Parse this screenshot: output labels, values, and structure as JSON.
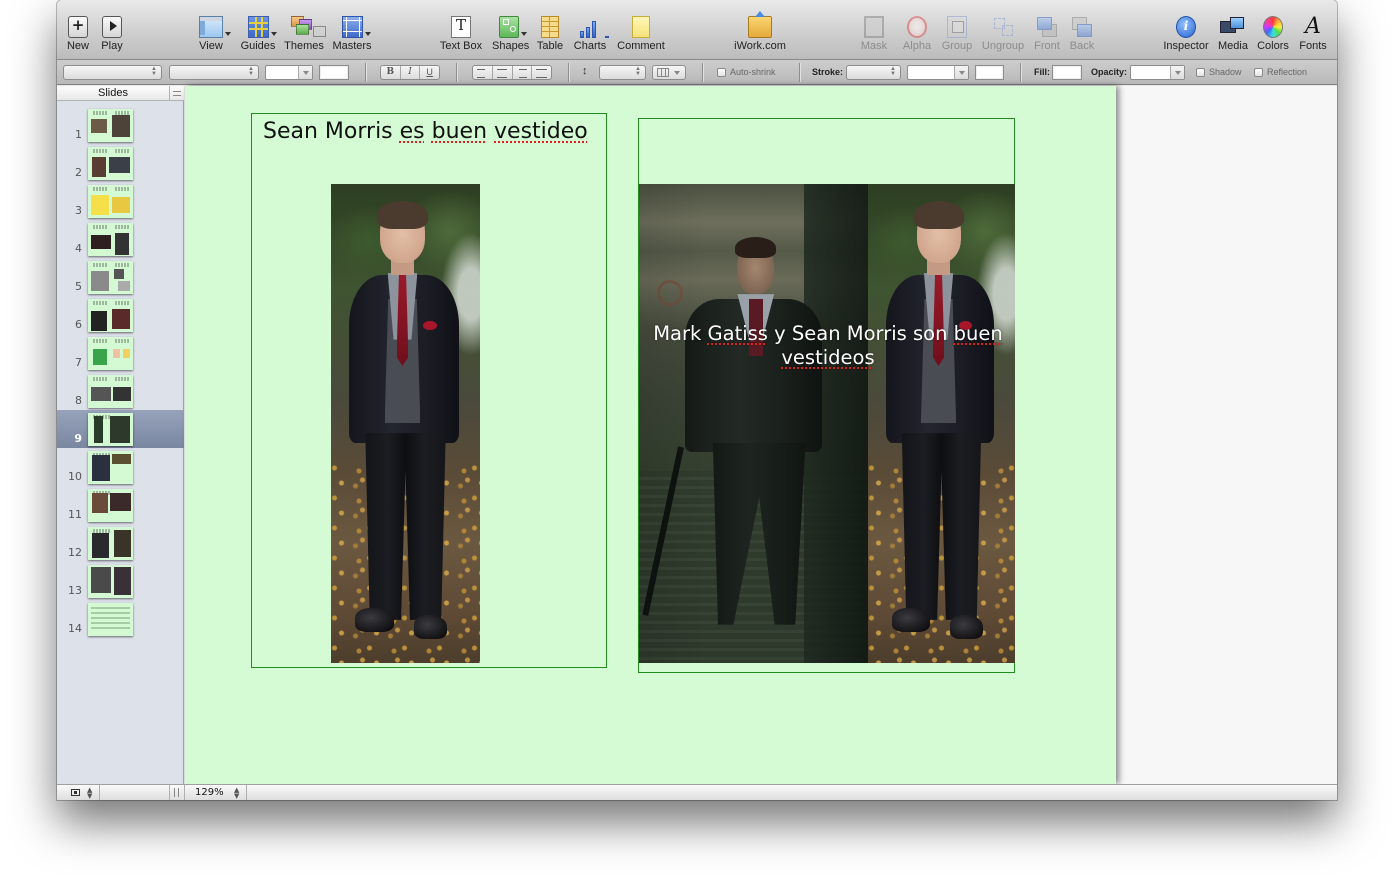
{
  "toolbar": {
    "new": "New",
    "play": "Play",
    "view": "View",
    "guides": "Guides",
    "themes": "Themes",
    "masters": "Masters",
    "text_box": "Text Box",
    "shapes": "Shapes",
    "table": "Table",
    "charts": "Charts",
    "comment": "Comment",
    "iwork": "iWork.com",
    "mask": "Mask",
    "alpha": "Alpha",
    "group": "Group",
    "ungroup": "Ungroup",
    "front": "Front",
    "back": "Back",
    "inspector": "Inspector",
    "media": "Media",
    "colors": "Colors",
    "fonts": "Fonts",
    "new_glyph": "+",
    "textbox_glyph": "T",
    "inspector_glyph": "i",
    "fonts_glyph": "A"
  },
  "format_bar": {
    "bold": "B",
    "italic": "I",
    "underline": "U",
    "auto_shrink": "Auto-shrink",
    "stroke_label": "Stroke:",
    "fill_label": "Fill:",
    "opacity_label": "Opacity:",
    "shadow": "Shadow",
    "reflection": "Reflection"
  },
  "navigator": {
    "title": "Slides",
    "selected_slide": 9,
    "slides": [
      {
        "number": "1"
      },
      {
        "number": "2"
      },
      {
        "number": "3"
      },
      {
        "number": "4"
      },
      {
        "number": "5"
      },
      {
        "number": "6"
      },
      {
        "number": "7"
      },
      {
        "number": "8"
      },
      {
        "number": "9"
      },
      {
        "number": "10"
      },
      {
        "number": "11"
      },
      {
        "number": "12"
      },
      {
        "number": "13"
      },
      {
        "number": "14"
      }
    ]
  },
  "slide": {
    "background_color": "#d4fbd4",
    "border_color": "#1f8e1f",
    "left_title_parts": [
      "Sean Morris ",
      "es",
      " ",
      "buen",
      " ",
      "vestideo"
    ],
    "right_caption_parts": [
      "Mark ",
      "Gatiss",
      " y Sean Morris son ",
      "buen",
      " ",
      "vestideos"
    ],
    "images": {
      "left": "photo-sean-morris",
      "right_1": "photo-mark-gatiss",
      "right_2": "photo-sean-morris"
    }
  },
  "status_bar": {
    "zoom": "129%"
  }
}
